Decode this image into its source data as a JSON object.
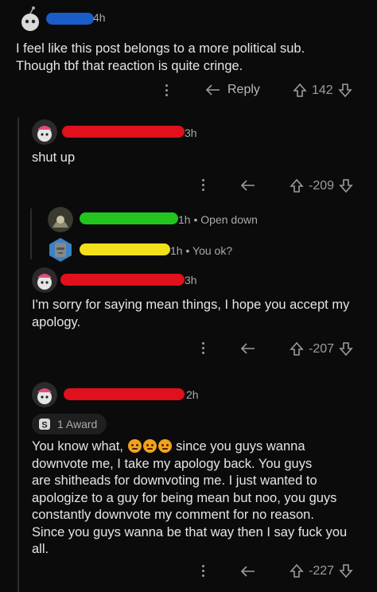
{
  "comments": [
    {
      "time": "4h",
      "text_lines": [
        "I feel like this post belongs to a more political sub.",
        "Though tbf that reaction is quite cringe."
      ],
      "reply_label": "Reply",
      "score": "142"
    },
    {
      "time": "3h",
      "text": "shut up",
      "score": "-209"
    },
    {
      "time": "1h",
      "preview": "Open down"
    },
    {
      "time": "1h",
      "preview": "You ok?"
    },
    {
      "time": "3h",
      "text_lines": [
        "I'm sorry for saying mean things, I hope you accept my",
        "apology."
      ],
      "score": "-207"
    },
    {
      "time": "2h",
      "award": "1 Award",
      "text_first": "You know what,",
      "text_first_after": "since you guys wanna",
      "text_lines": [
        "downvote me, I take my apology back. You guys",
        "are shitheads for downvoting me. I just wanted to",
        "apologize to a guy for being mean but noo, you guys",
        "constantly downvote my comment for no reason.",
        "Since you guys wanna be that way then I say fuck you",
        "all."
      ],
      "score": "-227"
    }
  ],
  "colors": {
    "redact_blue": "#1a5cc8",
    "redact_red": "#e0101c",
    "redact_green": "#22c51e",
    "redact_yellow": "#f2e01a"
  }
}
